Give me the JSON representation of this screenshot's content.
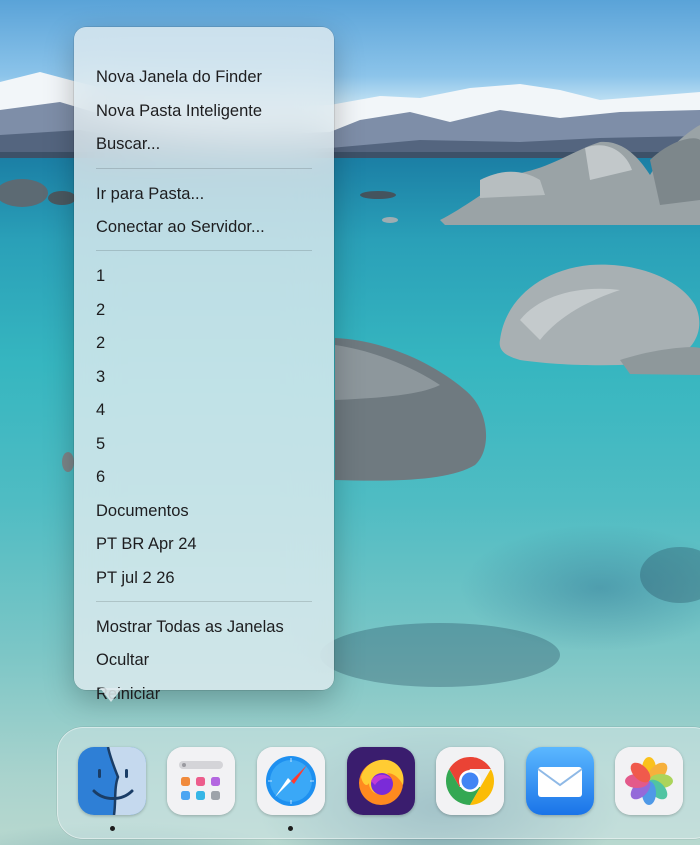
{
  "context_menu": {
    "items_group1": [
      "Nova Janela do Finder",
      "Nova Pasta Inteligente",
      "Buscar..."
    ],
    "items_group2": [
      "Ir para Pasta...",
      "Conectar ao Servidor..."
    ],
    "items_group3": [
      "1",
      "2",
      "2",
      "3",
      "4",
      "5",
      "6",
      "Documentos",
      "PT BR Apr 24",
      "PT jul 2 26"
    ],
    "items_group4": [
      "Mostrar Todas as Janelas",
      "Ocultar",
      "Reiniciar"
    ]
  },
  "dock": {
    "apps": [
      {
        "icon": "finder-icon",
        "running": true
      },
      {
        "icon": "launchpad-icon",
        "running": false
      },
      {
        "icon": "safari-icon",
        "running": true
      },
      {
        "icon": "firefox-icon",
        "running": false
      },
      {
        "icon": "chrome-icon",
        "running": false
      },
      {
        "icon": "mail-icon",
        "running": false
      },
      {
        "icon": "photos-icon",
        "running": false
      }
    ]
  },
  "colors": {
    "menu_background": "#e2ecf0",
    "finder_blue": "#2e7fd6",
    "mail_blue": "#2f8ff5"
  }
}
